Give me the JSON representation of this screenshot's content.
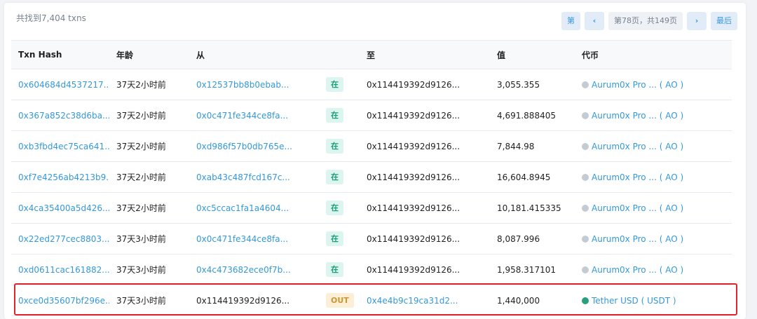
{
  "summary": "共找到7,404 txns",
  "pager": {
    "first": "第",
    "prev": "‹",
    "page_info": "第78页，共149页",
    "next": "›",
    "last": "最后"
  },
  "columns": [
    "Txn Hash",
    "年龄",
    "从",
    "",
    "至",
    "值",
    "代币"
  ],
  "rows": [
    {
      "hash": "0x604684d4537217...",
      "age": "37天2小时前",
      "from": "0x12537bb8b0ebab...",
      "dir": "在",
      "to": "0x114419392d9126...",
      "value": "3,055.355",
      "token": "Aurum0x Pro ... ( AO )"
    },
    {
      "hash": "0x367a852c38d6ba...",
      "age": "37天2小时前",
      "from": "0x0c471fe344ce8fa...",
      "dir": "在",
      "to": "0x114419392d9126...",
      "value": "4,691.888405",
      "token": "Aurum0x Pro ... ( AO )"
    },
    {
      "hash": "0xb3fbd4ec75ca641...",
      "age": "37天2小时前",
      "from": "0xd986f57b0db765e...",
      "dir": "在",
      "to": "0x114419392d9126...",
      "value": "7,844.98",
      "token": "Aurum0x Pro ... ( AO )"
    },
    {
      "hash": "0xf7e4256ab4213b9...",
      "age": "37天2小时前",
      "from": "0xab43c487fcd167c...",
      "dir": "在",
      "to": "0x114419392d9126...",
      "value": "16,604.8945",
      "token": "Aurum0x Pro ... ( AO )"
    },
    {
      "hash": "0x4ca35400a5d426...",
      "age": "37天2小时前",
      "from": "0xc5ccac1fa1a4604...",
      "dir": "在",
      "to": "0x114419392d9126...",
      "value": "10,181.415335",
      "token": "Aurum0x Pro ... ( AO )"
    },
    {
      "hash": "0x22ed277cec8803...",
      "age": "37天3小时前",
      "from": "0x0c471fe344ce8fa...",
      "dir": "在",
      "to": "0x114419392d9126...",
      "value": "8,087.996",
      "token": "Aurum0x Pro ... ( AO )"
    },
    {
      "hash": "0xd0611cac161882...",
      "age": "37天3小时前",
      "from": "0x4c473682ece0f7b...",
      "dir": "在",
      "to": "0x114419392d9126...",
      "value": "1,958.317101",
      "token": "Aurum0x Pro ... ( AO )"
    },
    {
      "hash": "0xce0d35607bf296e...",
      "age": "37天3小时前",
      "from": "0x114419392d9126...",
      "dir": "OUT",
      "to": "0x4e4b9c19ca31d2...",
      "value": "1,440,000",
      "token": "Tether USD ( USDT )"
    }
  ],
  "colors": {
    "link": "#3498db",
    "in_badge": "#dcf5ef",
    "out_badge": "#fcefd6",
    "highlight": "#e0242b"
  }
}
